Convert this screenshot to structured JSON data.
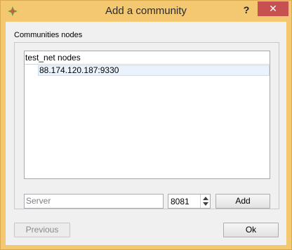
{
  "window": {
    "title": "Add a community",
    "help_label": "?",
    "close_label": "✕",
    "app_icon": "app-logo-icon"
  },
  "group": {
    "label": "Communities nodes"
  },
  "tree": {
    "header": "test_net nodes",
    "rows": [
      "88.174.120.187:9330"
    ]
  },
  "server": {
    "placeholder": "Server",
    "value": ""
  },
  "port": {
    "value": "8081"
  },
  "buttons": {
    "add": "Add",
    "previous": "Previous",
    "ok": "Ok"
  },
  "colors": {
    "frame": "#f3c870",
    "close": "#c75050",
    "selection": "#eaf3fc"
  }
}
